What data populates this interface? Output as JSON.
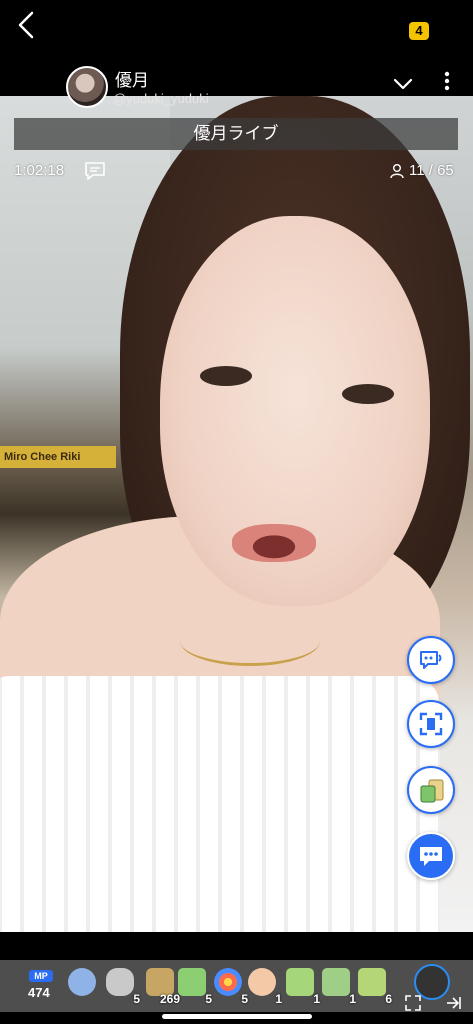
{
  "status": {
    "battery_level": "4"
  },
  "header": {
    "streamer_name": "優月",
    "streamer_handle": "@yuduki_yuduki"
  },
  "stream": {
    "title": "優月ライブ",
    "elapsed": "1:02:18",
    "viewer_count": "11 / 65",
    "background_sign": "Miro Chee Riki"
  },
  "wallet": {
    "badge": "MP",
    "value": "474"
  },
  "gifts": [
    {
      "icon": "smile-face-icon",
      "count": ""
    },
    {
      "icon": "stone-icon",
      "count": "5"
    },
    {
      "icon": "house-icon",
      "count": "269"
    },
    {
      "icon": "green-card-icon",
      "count": "5"
    },
    {
      "icon": "fireworks-icon",
      "count": "5"
    },
    {
      "icon": "clap-hands-icon",
      "count": "1"
    },
    {
      "icon": "leaf-card-icon",
      "count": "1"
    },
    {
      "icon": "100-card-icon",
      "count": "1"
    },
    {
      "icon": "30-card-icon",
      "count": "6"
    }
  ],
  "colors": {
    "accent": "#2a6df4",
    "battery": "#f5c400",
    "gift_bar": "#4e4e4e",
    "title_bar": "#3c3c3c"
  }
}
